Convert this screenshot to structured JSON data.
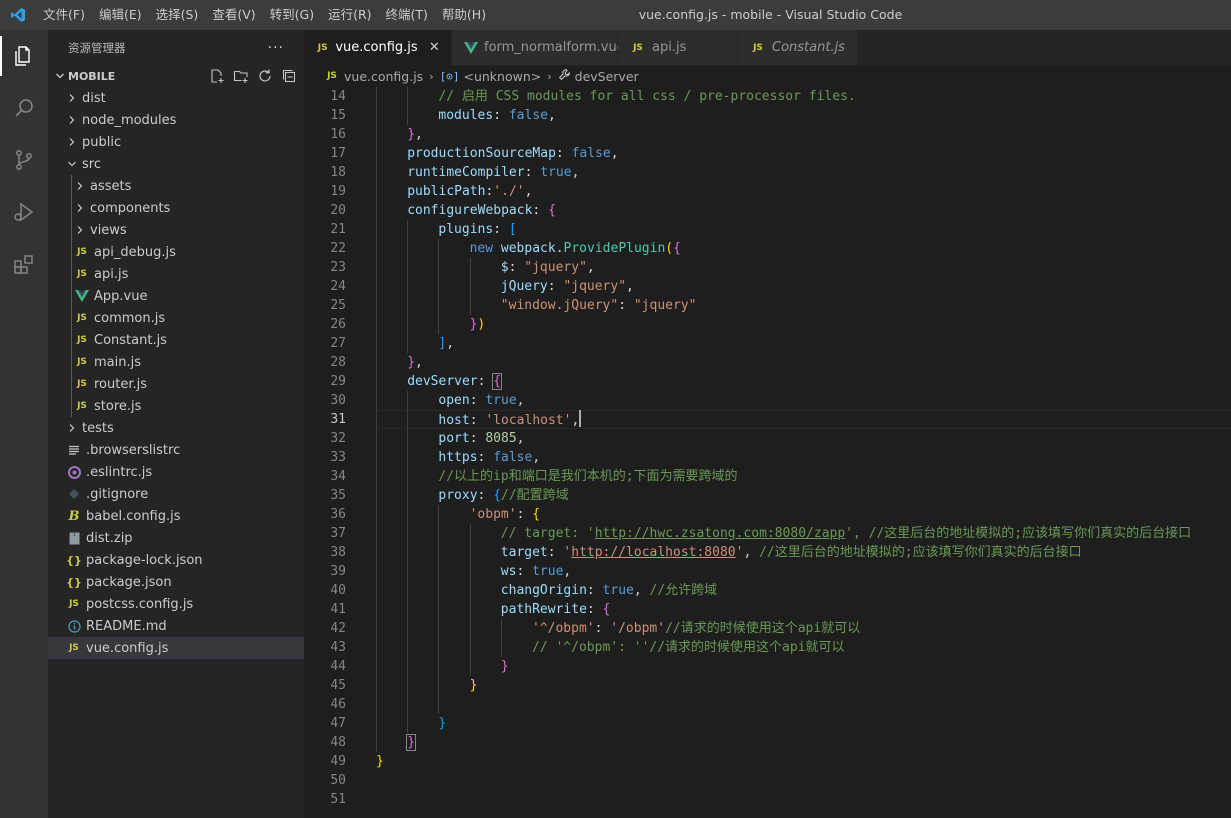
{
  "titlebar": {
    "menu": [
      "文件(F)",
      "编辑(E)",
      "选择(S)",
      "查看(V)",
      "转到(G)",
      "运行(R)",
      "终端(T)",
      "帮助(H)"
    ],
    "window_title": "vue.config.js - mobile - Visual Studio Code"
  },
  "sidebar": {
    "title": "资源管理器",
    "more": "···",
    "section": "MOBILE",
    "tree": [
      {
        "label": "dist",
        "type": "folder",
        "depth": 0,
        "open": false
      },
      {
        "label": "node_modules",
        "type": "folder",
        "depth": 0,
        "open": false
      },
      {
        "label": "public",
        "type": "folder",
        "depth": 0,
        "open": false
      },
      {
        "label": "src",
        "type": "folder",
        "depth": 0,
        "open": true
      },
      {
        "label": "assets",
        "type": "folder",
        "depth": 1,
        "open": false
      },
      {
        "label": "components",
        "type": "folder",
        "depth": 1,
        "open": false
      },
      {
        "label": "views",
        "type": "folder",
        "depth": 1,
        "open": false
      },
      {
        "label": "api_debug.js",
        "type": "js",
        "depth": 1
      },
      {
        "label": "api.js",
        "type": "js",
        "depth": 1
      },
      {
        "label": "App.vue",
        "type": "vue",
        "depth": 1
      },
      {
        "label": "common.js",
        "type": "js",
        "depth": 1
      },
      {
        "label": "Constant.js",
        "type": "js",
        "depth": 1
      },
      {
        "label": "main.js",
        "type": "js",
        "depth": 1
      },
      {
        "label": "router.js",
        "type": "js",
        "depth": 1
      },
      {
        "label": "store.js",
        "type": "js",
        "depth": 1
      },
      {
        "label": "tests",
        "type": "folder",
        "depth": 0,
        "open": false
      },
      {
        "label": ".browserslistrc",
        "type": "lines",
        "depth": 0
      },
      {
        "label": ".eslintrc.js",
        "type": "eslint",
        "depth": 0
      },
      {
        "label": ".gitignore",
        "type": "git",
        "depth": 0
      },
      {
        "label": "babel.config.js",
        "type": "babel",
        "depth": 0
      },
      {
        "label": "dist.zip",
        "type": "zip",
        "depth": 0
      },
      {
        "label": "package-lock.json",
        "type": "json",
        "depth": 0
      },
      {
        "label": "package.json",
        "type": "json",
        "depth": 0
      },
      {
        "label": "postcss.config.js",
        "type": "js",
        "depth": 0
      },
      {
        "label": "README.md",
        "type": "info",
        "depth": 0
      },
      {
        "label": "vue.config.js",
        "type": "js",
        "depth": 0,
        "selected": true
      }
    ]
  },
  "tabs": [
    {
      "label": "vue.config.js",
      "icon": "JS",
      "active": true,
      "close": "✕"
    },
    {
      "label": "form_normalform.vue",
      "icon": "vue"
    },
    {
      "label": "api.js",
      "icon": "JS"
    },
    {
      "label": "Constant.js",
      "icon": "JS",
      "italic": true
    }
  ],
  "breadcrumb": {
    "file_icon": "JS",
    "file": "vue.config.js",
    "symbol": "<unknown>",
    "property": "devServer"
  },
  "editor": {
    "current_line": 31,
    "lines": [
      {
        "n": 14,
        "indent": 2,
        "tokens": [
          [
            "com",
            "// 启用 CSS modules for all css / pre-processor files."
          ]
        ]
      },
      {
        "n": 15,
        "indent": 2,
        "tokens": [
          [
            "prop",
            "modules"
          ],
          [
            "p",
            ": "
          ],
          [
            "kw",
            "false"
          ],
          [
            "p",
            ","
          ]
        ]
      },
      {
        "n": 16,
        "indent": 1,
        "tokens": [
          [
            "b2",
            "}"
          ],
          [
            "p",
            ","
          ]
        ]
      },
      {
        "n": 17,
        "indent": 1,
        "tokens": [
          [
            "prop",
            "productionSourceMap"
          ],
          [
            "p",
            ": "
          ],
          [
            "kw",
            "false"
          ],
          [
            "p",
            ","
          ]
        ]
      },
      {
        "n": 18,
        "indent": 1,
        "tokens": [
          [
            "prop",
            "runtimeCompiler"
          ],
          [
            "p",
            ": "
          ],
          [
            "kw",
            "true"
          ],
          [
            "p",
            ","
          ]
        ]
      },
      {
        "n": 19,
        "indent": 1,
        "tokens": [
          [
            "prop",
            "publicPath"
          ],
          [
            "p",
            ":"
          ],
          [
            "str",
            "'./'"
          ],
          [
            "p",
            ","
          ]
        ]
      },
      {
        "n": 20,
        "indent": 1,
        "tokens": [
          [
            "prop",
            "configureWebpack"
          ],
          [
            "p",
            ": "
          ],
          [
            "b2",
            "{"
          ]
        ]
      },
      {
        "n": 21,
        "indent": 2,
        "tokens": [
          [
            "prop",
            "plugins"
          ],
          [
            "p",
            ": "
          ],
          [
            "b3",
            "["
          ]
        ]
      },
      {
        "n": 22,
        "indent": 3,
        "tokens": [
          [
            "kw",
            "new "
          ],
          [
            "prop",
            "webpack"
          ],
          [
            "p",
            "."
          ],
          [
            "cls",
            "ProvidePlugin"
          ],
          [
            "b1",
            "("
          ],
          [
            "b2",
            "{"
          ]
        ]
      },
      {
        "n": 23,
        "indent": 4,
        "tokens": [
          [
            "prop",
            "$"
          ],
          [
            "p",
            ": "
          ],
          [
            "str",
            "\"jquery\""
          ],
          [
            "p",
            ","
          ]
        ]
      },
      {
        "n": 24,
        "indent": 4,
        "tokens": [
          [
            "prop",
            "jQuery"
          ],
          [
            "p",
            ": "
          ],
          [
            "str",
            "\"jquery\""
          ],
          [
            "p",
            ","
          ]
        ]
      },
      {
        "n": 25,
        "indent": 4,
        "tokens": [
          [
            "str",
            "\"window.jQuery\""
          ],
          [
            "p",
            ": "
          ],
          [
            "str",
            "\"jquery\""
          ]
        ]
      },
      {
        "n": 26,
        "indent": 3,
        "tokens": [
          [
            "b2",
            "}"
          ],
          [
            "b1",
            ")"
          ]
        ]
      },
      {
        "n": 27,
        "indent": 2,
        "tokens": [
          [
            "b3",
            "]"
          ],
          [
            "p",
            ","
          ]
        ]
      },
      {
        "n": 28,
        "indent": 1,
        "tokens": [
          [
            "b2",
            "}"
          ],
          [
            "p",
            ","
          ]
        ]
      },
      {
        "n": 29,
        "indent": 1,
        "tokens": [
          [
            "prop",
            "devServer"
          ],
          [
            "p",
            ": "
          ],
          [
            "b2m",
            "{"
          ]
        ]
      },
      {
        "n": 30,
        "indent": 2,
        "tokens": [
          [
            "prop",
            "open"
          ],
          [
            "p",
            ": "
          ],
          [
            "kw",
            "true"
          ],
          [
            "p",
            ","
          ]
        ]
      },
      {
        "n": 31,
        "indent": 2,
        "tokens": [
          [
            "prop",
            "host"
          ],
          [
            "p",
            ": "
          ],
          [
            "str",
            "'localhost'"
          ],
          [
            "p",
            ","
          ],
          [
            "cursor",
            ""
          ]
        ]
      },
      {
        "n": 32,
        "indent": 2,
        "tokens": [
          [
            "prop",
            "port"
          ],
          [
            "p",
            ": "
          ],
          [
            "num",
            "8085"
          ],
          [
            "p",
            ","
          ]
        ]
      },
      {
        "n": 33,
        "indent": 2,
        "tokens": [
          [
            "prop",
            "https"
          ],
          [
            "p",
            ": "
          ],
          [
            "kw",
            "false"
          ],
          [
            "p",
            ","
          ]
        ]
      },
      {
        "n": 34,
        "indent": 2,
        "tokens": [
          [
            "com",
            "//以上的ip和端口是我们本机的;下面为需要跨域的"
          ]
        ]
      },
      {
        "n": 35,
        "indent": 2,
        "tokens": [
          [
            "prop",
            "proxy"
          ],
          [
            "p",
            ": "
          ],
          [
            "b3",
            "{"
          ],
          [
            "com",
            "//配置跨域"
          ]
        ]
      },
      {
        "n": 36,
        "indent": 3,
        "tokens": [
          [
            "str",
            "'obpm'"
          ],
          [
            "p",
            ": "
          ],
          [
            "b1",
            "{"
          ]
        ]
      },
      {
        "n": 37,
        "indent": 4,
        "tokens": [
          [
            "com",
            "// target: '"
          ],
          [
            "comurl",
            "http://hwc.zsatong.com:8080/zapp"
          ],
          [
            "com",
            "', //这里后台的地址模拟的;应该填写你们真实的后台接口"
          ]
        ]
      },
      {
        "n": 38,
        "indent": 4,
        "tokens": [
          [
            "prop",
            "target"
          ],
          [
            "p",
            ": "
          ],
          [
            "str",
            "'"
          ],
          [
            "url",
            "http://localhost:8080"
          ],
          [
            "str",
            "'"
          ],
          [
            "p",
            ", "
          ],
          [
            "com",
            "//这里后台的地址模拟的;应该填写你们真实的后台接口"
          ]
        ]
      },
      {
        "n": 39,
        "indent": 4,
        "tokens": [
          [
            "prop",
            "ws"
          ],
          [
            "p",
            ": "
          ],
          [
            "kw",
            "true"
          ],
          [
            "p",
            ","
          ]
        ]
      },
      {
        "n": 40,
        "indent": 4,
        "tokens": [
          [
            "prop",
            "changOrigin"
          ],
          [
            "p",
            ": "
          ],
          [
            "kw",
            "true"
          ],
          [
            "p",
            ", "
          ],
          [
            "com",
            "//允许跨域"
          ]
        ]
      },
      {
        "n": 41,
        "indent": 4,
        "tokens": [
          [
            "prop",
            "pathRewrite"
          ],
          [
            "p",
            ": "
          ],
          [
            "b2",
            "{"
          ]
        ]
      },
      {
        "n": 42,
        "indent": 5,
        "tokens": [
          [
            "str",
            "'^/obpm'"
          ],
          [
            "p",
            ": "
          ],
          [
            "str",
            "'/obpm'"
          ],
          [
            "com",
            "//请求的时候使用这个api就可以"
          ]
        ]
      },
      {
        "n": 43,
        "indent": 5,
        "tokens": [
          [
            "com",
            "// '^/obpm': ''//请求的时候使用这个api就可以"
          ]
        ]
      },
      {
        "n": 44,
        "indent": 4,
        "tokens": [
          [
            "b2",
            "}"
          ]
        ]
      },
      {
        "n": 45,
        "indent": 3,
        "tokens": [
          [
            "b1",
            "}"
          ]
        ]
      },
      {
        "n": 46,
        "indent": 0,
        "tokens": []
      },
      {
        "n": 47,
        "indent": 2,
        "tokens": [
          [
            "b3",
            "}"
          ]
        ]
      },
      {
        "n": 48,
        "indent": 1,
        "tokens": [
          [
            "b2m",
            "}"
          ]
        ]
      },
      {
        "n": 49,
        "indent": 0,
        "tokens": [
          [
            "b1",
            "}"
          ]
        ]
      },
      {
        "n": 50,
        "indent": 0,
        "tokens": []
      },
      {
        "n": 51,
        "indent": 0,
        "tokens": []
      }
    ]
  }
}
